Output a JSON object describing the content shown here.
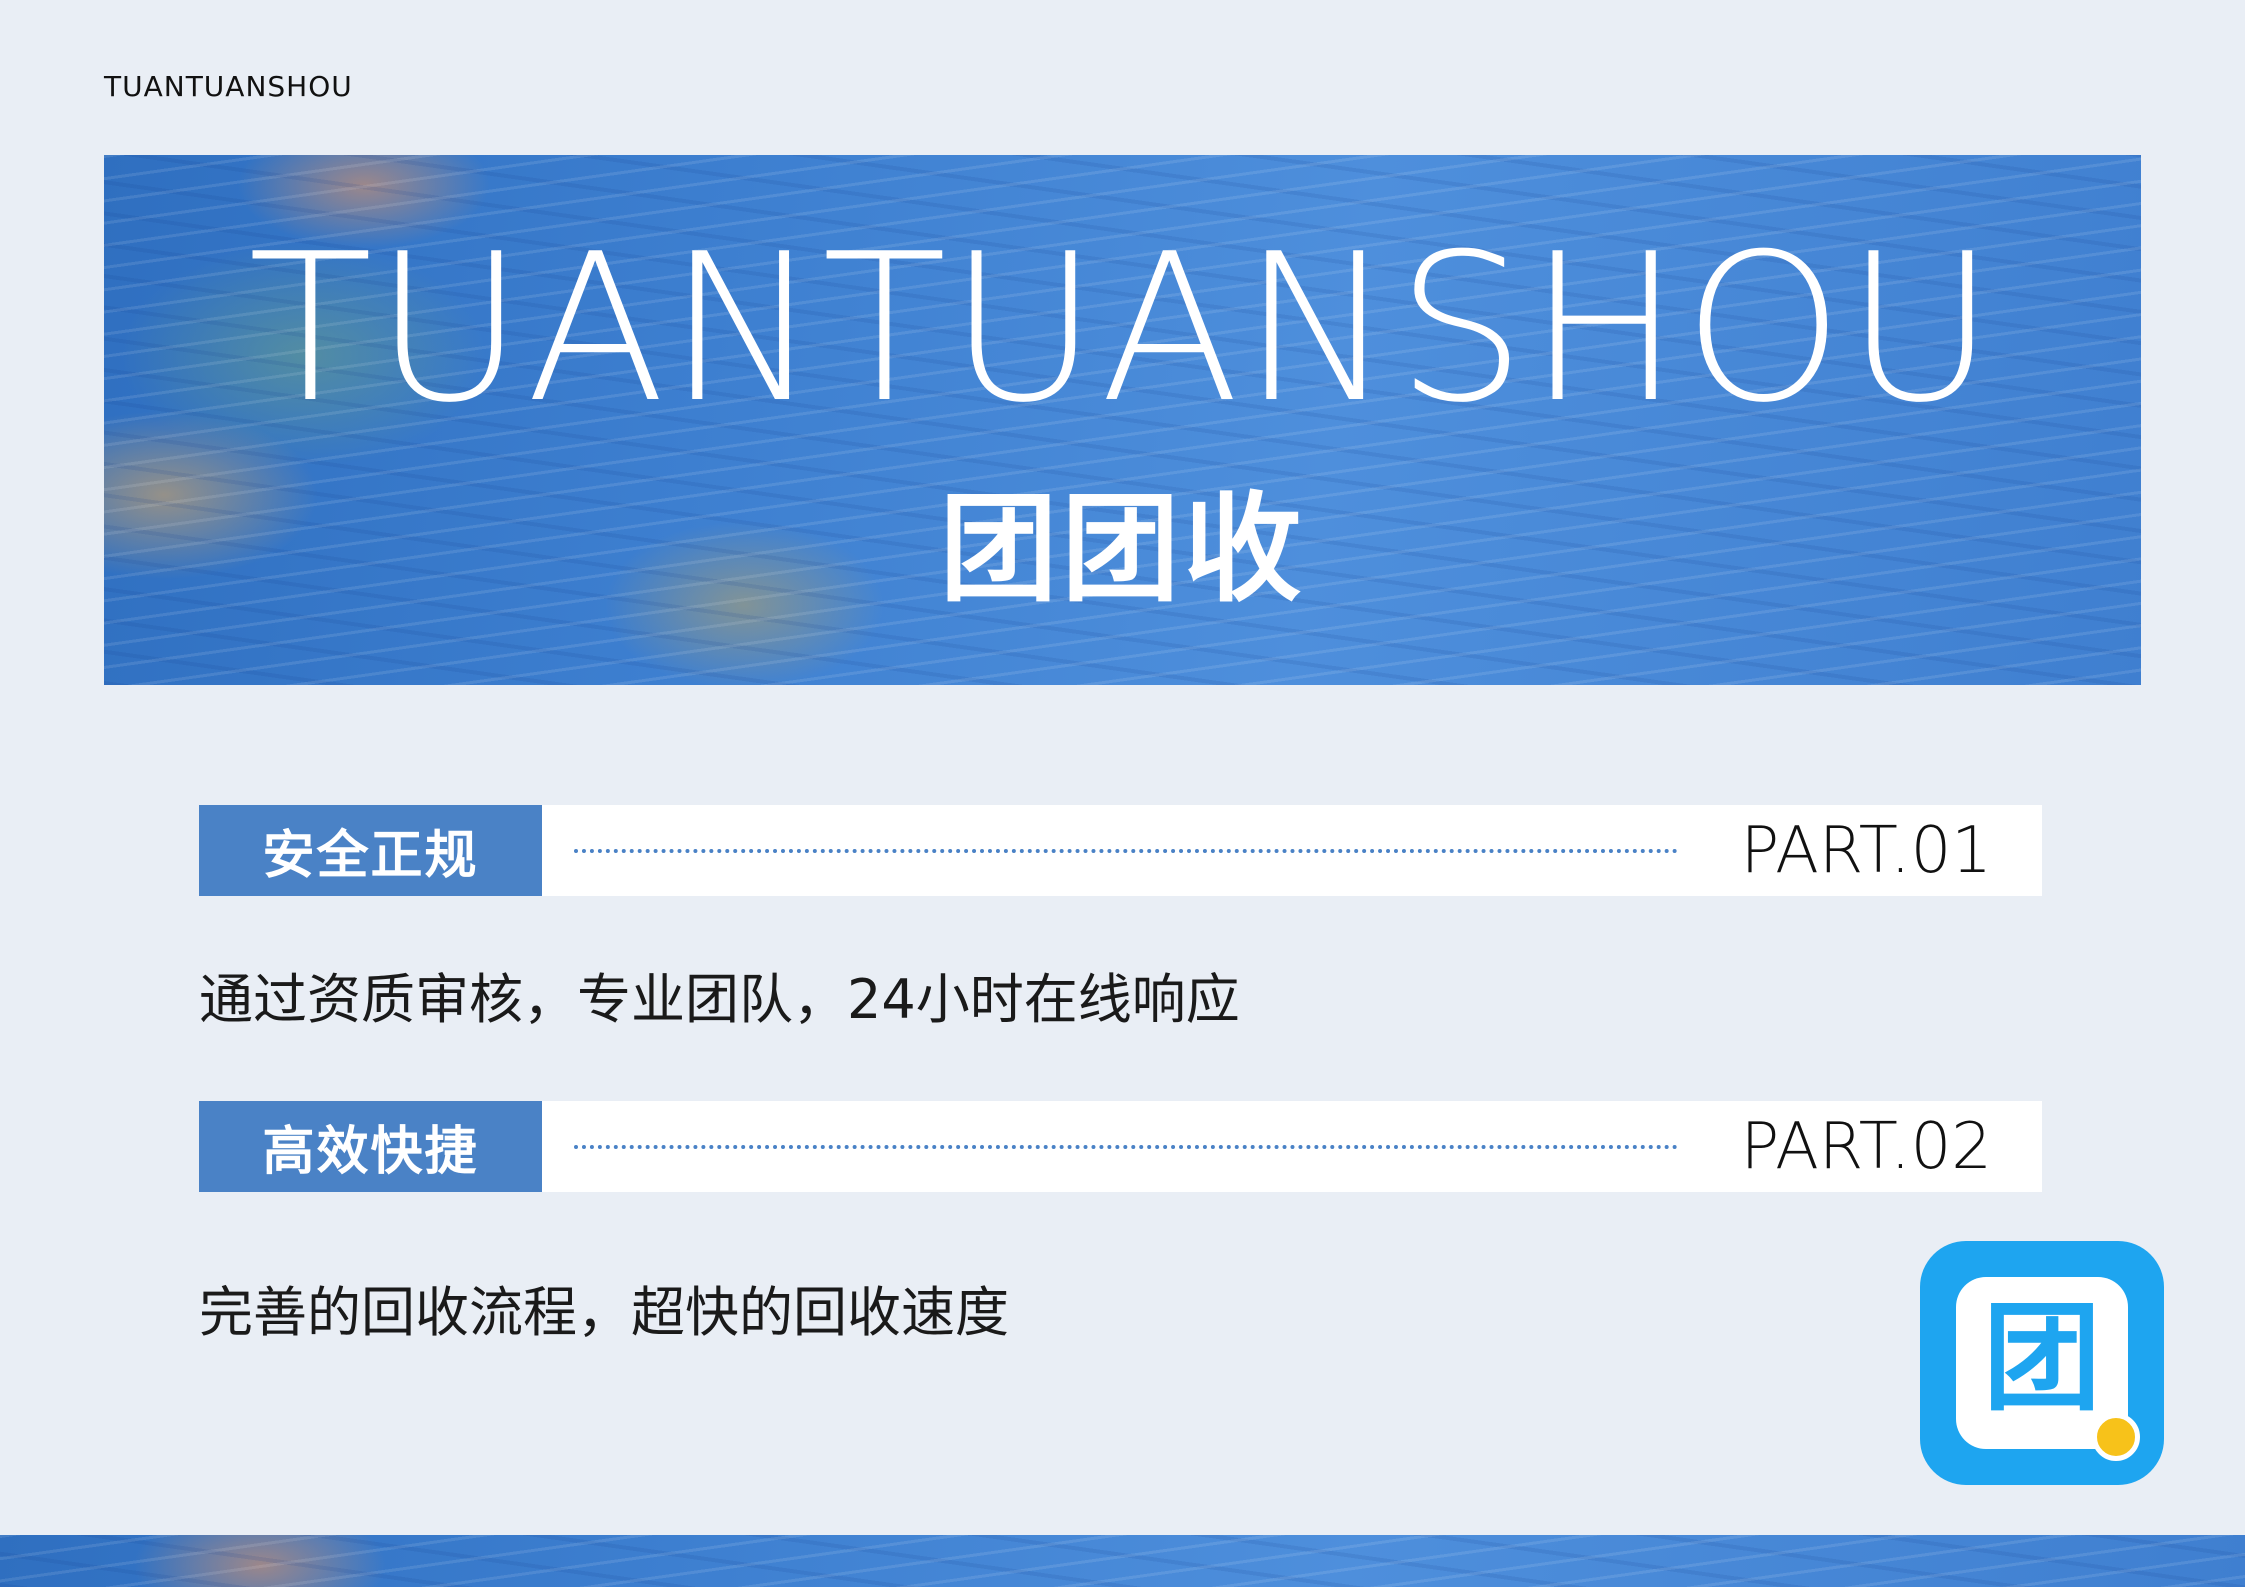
{
  "header": {
    "brand": "TUANTUANSHOU"
  },
  "banner": {
    "title_en": "TUANTUANSHOU",
    "title_zh": "团团收"
  },
  "sections": [
    {
      "tag": "安全正规",
      "part": "PART.01",
      "description": "通过资质审核，专业团队，24小时在线响应"
    },
    {
      "tag": "高效快捷",
      "part": "PART.02",
      "description": "完善的回收流程，超快的回收速度"
    }
  ],
  "logo": {
    "glyph": "团",
    "icon": "tuantuanshou-app-icon"
  },
  "colors": {
    "background": "#e9eef5",
    "accent": "#4a82c6",
    "logo_blue": "#1ea5f0",
    "logo_coin": "#f7c21a"
  }
}
